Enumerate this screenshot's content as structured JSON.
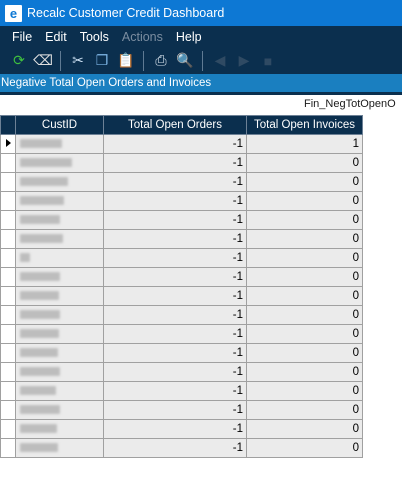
{
  "window": {
    "title": "Recalc Customer Credit Dashboard",
    "icon_letter": "e"
  },
  "menu": [
    {
      "label": "File",
      "enabled": true
    },
    {
      "label": "Edit",
      "enabled": true
    },
    {
      "label": "Tools",
      "enabled": true
    },
    {
      "label": "Actions",
      "enabled": false
    },
    {
      "label": "Help",
      "enabled": true
    }
  ],
  "toolbar": {
    "buttons": [
      {
        "name": "refresh-icon",
        "glyph": "⟳",
        "color": "#3fbf3f"
      },
      {
        "name": "eraser-icon",
        "glyph": "⌫",
        "color": "#e0e0e0"
      },
      {
        "name": "cut-icon",
        "glyph": "✂",
        "color": "#cfe3f5"
      },
      {
        "name": "copy-icon",
        "glyph": "❐",
        "color": "#7fb7e8"
      },
      {
        "name": "paste-icon",
        "glyph": "📋",
        "color": "#e6b65a"
      },
      {
        "name": "print-icon",
        "glyph": "⎙",
        "color": "#d9e4ee"
      },
      {
        "name": "print-preview-icon",
        "glyph": "🔍",
        "color": "#7fb7e8"
      },
      {
        "name": "nav-back-icon",
        "glyph": "◀",
        "color": "#2f4a63"
      },
      {
        "name": "nav-forward-icon",
        "glyph": "▶",
        "color": "#2f4a63"
      },
      {
        "name": "stop-icon",
        "glyph": "■",
        "color": "#2f4a63"
      }
    ]
  },
  "panel": {
    "header": "Negative Total Open Orders and Invoices",
    "report_name": "Fin_NegTotOpenO"
  },
  "grid": {
    "columns": [
      "CustID",
      "Total Open Orders",
      "Total Open Invoices"
    ],
    "rows": [
      {
        "custid_width": 42,
        "orders": "-1",
        "invoices": "1"
      },
      {
        "custid_width": 52,
        "orders": "-1",
        "invoices": "0"
      },
      {
        "custid_width": 48,
        "orders": "-1",
        "invoices": "0"
      },
      {
        "custid_width": 44,
        "orders": "-1",
        "invoices": "0"
      },
      {
        "custid_width": 40,
        "orders": "-1",
        "invoices": "0"
      },
      {
        "custid_width": 43,
        "orders": "-1",
        "invoices": "0"
      },
      {
        "custid_width": 10,
        "orders": "-1",
        "invoices": "0"
      },
      {
        "custid_width": 40,
        "orders": "-1",
        "invoices": "0"
      },
      {
        "custid_width": 39,
        "orders": "-1",
        "invoices": "0"
      },
      {
        "custid_width": 40,
        "orders": "-1",
        "invoices": "0"
      },
      {
        "custid_width": 39,
        "orders": "-1",
        "invoices": "0"
      },
      {
        "custid_width": 38,
        "orders": "-1",
        "invoices": "0"
      },
      {
        "custid_width": 40,
        "orders": "-1",
        "invoices": "0"
      },
      {
        "custid_width": 36,
        "orders": "-1",
        "invoices": "0"
      },
      {
        "custid_width": 40,
        "orders": "-1",
        "invoices": "0"
      },
      {
        "custid_width": 37,
        "orders": "-1",
        "invoices": "0"
      },
      {
        "custid_width": 38,
        "orders": "-1",
        "invoices": "0"
      }
    ]
  },
  "colors": {
    "titlebar": "#0d78d4",
    "menubar": "#0b2f4e",
    "panel_header": "#1a7fc0",
    "grid_header": "#0b2f4e",
    "cell_bg": "#ebebeb"
  }
}
